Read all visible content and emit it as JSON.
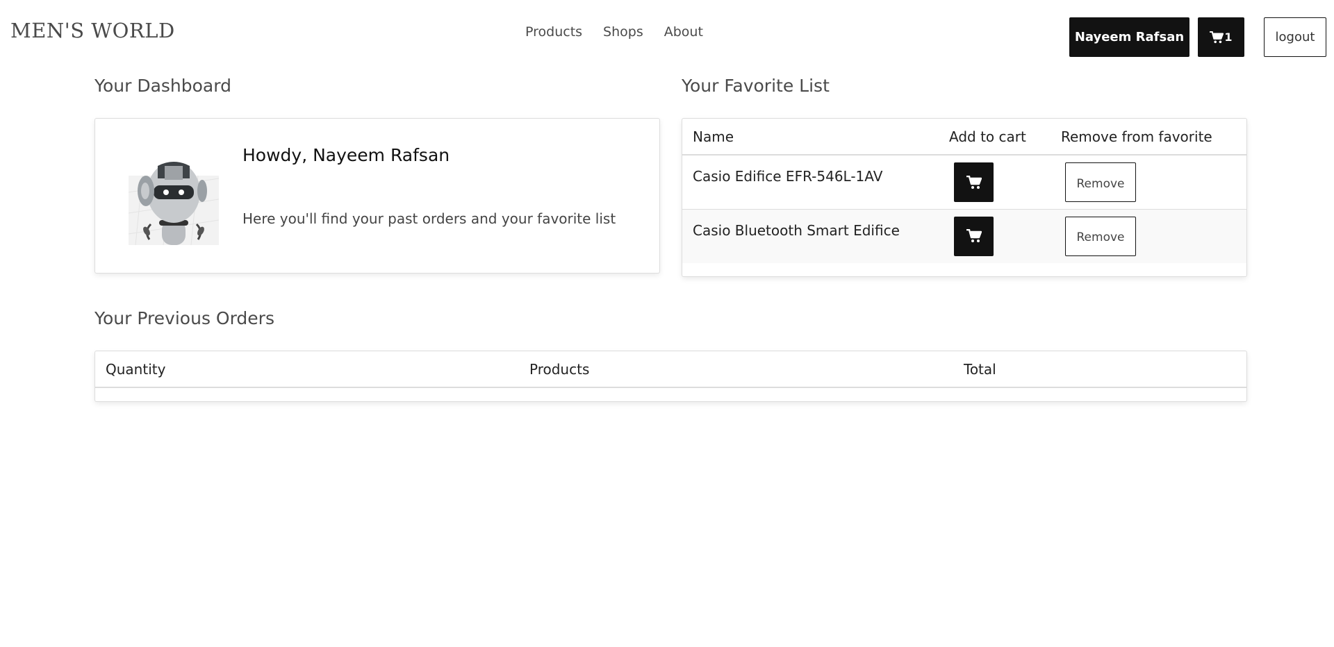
{
  "header": {
    "brand": "MEN'S WORLD",
    "nav": [
      "Products",
      "Shops",
      "About"
    ],
    "user_name": "Nayeem Rafsan",
    "cart_count": "1",
    "logout_label": "logout"
  },
  "dashboard": {
    "title": "Your Dashboard",
    "greeting": "Howdy, Nayeem Rafsan",
    "description": "Here you'll find your past orders and your favorite list"
  },
  "favorites": {
    "title": "Your Favorite List",
    "columns": [
      "Name",
      "Add to cart",
      "Remove from favorite"
    ],
    "items": [
      {
        "name": "Casio Edifice EFR-546L-1AV",
        "remove_label": "Remove"
      },
      {
        "name": "Casio Bluetooth Smart Edifice",
        "remove_label": "Remove"
      }
    ]
  },
  "orders": {
    "title": "Your Previous Orders",
    "columns": [
      "Quantity",
      "Products",
      "Total"
    ],
    "rows": []
  },
  "colors": {
    "button_dark": "#121212",
    "text_muted": "#4a4a4a",
    "border": "#dcdcdc"
  }
}
